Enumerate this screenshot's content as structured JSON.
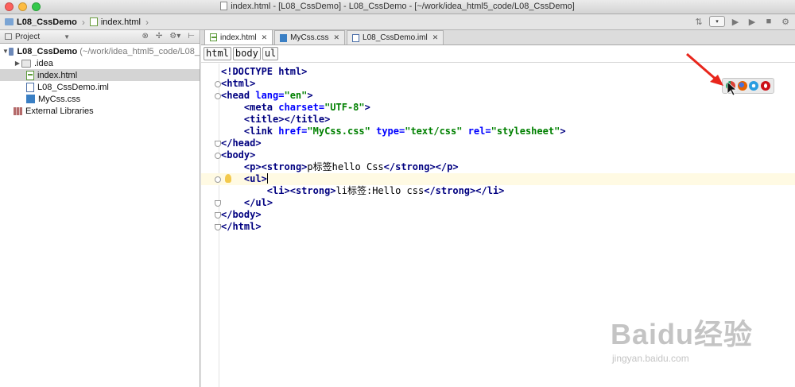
{
  "window": {
    "title": "index.html - [L08_CssDemo] - L08_CssDemo - [~/work/idea_html5_code/L08_CssDemo]"
  },
  "navbar": {
    "crumbs": [
      "L08_CssDemo",
      "index.html"
    ]
  },
  "project": {
    "header_label": "Project",
    "tree": [
      {
        "label": "L08_CssDemo",
        "path": "(~/work/idea_html5_code/L08_",
        "type": "project",
        "expanded": true
      },
      {
        "label": ".idea",
        "type": "folder",
        "expanded": false
      },
      {
        "label": "index.html",
        "type": "html",
        "selected": true
      },
      {
        "label": "L08_CssDemo.iml",
        "type": "iml"
      },
      {
        "label": "MyCss.css",
        "type": "css"
      },
      {
        "label": "External Libraries",
        "type": "lib"
      }
    ]
  },
  "editor": {
    "tabs": [
      {
        "label": "index.html",
        "active": true
      },
      {
        "label": "MyCss.css",
        "active": false
      },
      {
        "label": "L08_CssDemo.iml",
        "active": false
      }
    ],
    "tag_breadcrumbs": [
      "html",
      "body",
      "ul"
    ],
    "code_lines": [
      "<!DOCTYPE html>",
      "<html>",
      "<head lang=\"en\">",
      "    <meta charset=\"UTF-8\">",
      "    <title></title>",
      "    <link href=\"MyCss.css\" type=\"text/css\" rel=\"stylesheet\">",
      "</head>",
      "<body>",
      "    <p><strong>p标签hello Css</strong></p>",
      "    <ul>",
      "        <li><strong>li标签:Hello css</strong></li>",
      "    </ul>",
      "</body>",
      "</html>"
    ]
  },
  "browser_popup": {
    "icons": [
      "chrome-icon",
      "firefox-icon",
      "safari-icon",
      "opera-icon"
    ]
  },
  "watermark": {
    "main": "Baidu经验",
    "sub": "jingyan.baidu.com"
  },
  "colors": {
    "tag": "#000080",
    "string": "#008000",
    "attribute": "#0000ff",
    "current_line": "#fffae3",
    "arrow": "#e8261c"
  }
}
